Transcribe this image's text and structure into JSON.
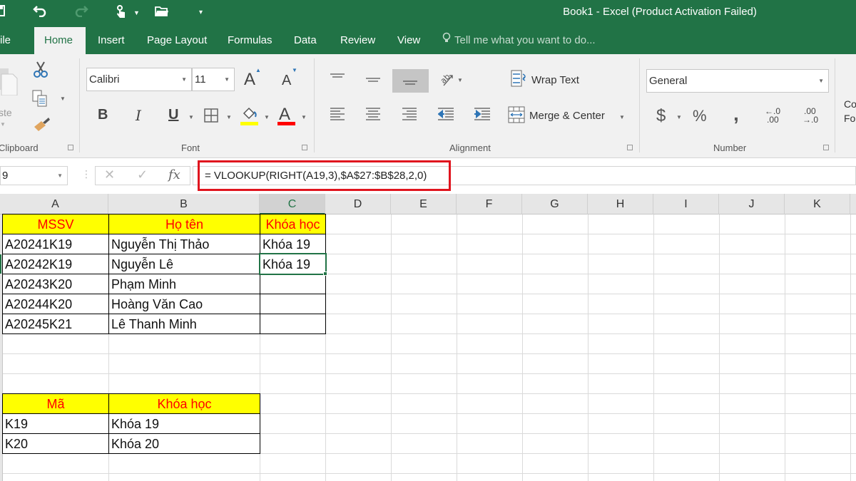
{
  "window": {
    "title": "Book1 - Excel (Product Activation Failed)"
  },
  "quick_access": {
    "save_icon": "save-icon",
    "undo_icon": "undo-icon",
    "redo_icon": "redo-icon",
    "touch_mode_icon": "touch-mode-icon",
    "open_icon": "open-folder-icon",
    "customize_icon": "customize-qat-icon"
  },
  "tabs": [
    {
      "label": "ile"
    },
    {
      "label": "Home",
      "active": true
    },
    {
      "label": "Insert"
    },
    {
      "label": "Page Layout"
    },
    {
      "label": "Formulas"
    },
    {
      "label": "Data"
    },
    {
      "label": "Review"
    },
    {
      "label": "View"
    }
  ],
  "tell_me": {
    "placeholder": "Tell me what you want to do..."
  },
  "ribbon": {
    "clipboard": {
      "label": "Clipboard",
      "paste_label": "ste"
    },
    "font": {
      "label": "Font",
      "font_name": "Calibri",
      "font_size": "11",
      "bold": "B",
      "italic": "I",
      "underline": "U",
      "grow_font": "A",
      "shrink_font": "A",
      "font_color_letter": "A",
      "highlight_color": "#ffff00",
      "font_color": "#ff0000"
    },
    "alignment": {
      "label": "Alignment",
      "wrap_text": "Wrap Text",
      "merge_center": "Merge & Center"
    },
    "number": {
      "label": "Number",
      "format": "General",
      "currency": "$",
      "percent": "%",
      "comma": ",",
      "increase_decimal_top": "←.0",
      "increase_decimal_bottom": ".00",
      "decrease_decimal_top": ".00",
      "decrease_decimal_bottom": "→.0"
    },
    "styles": {
      "conditional_formatting_line1": "Co",
      "conditional_formatting_line2": "For"
    }
  },
  "formula_bar": {
    "name_box": "9",
    "cancel": "✕",
    "enter": "✓",
    "fx": "fx",
    "formula": "= VLOOKUP(RIGHT(A19,3),$A$27:$B$28,2,0)"
  },
  "columns": [
    "A",
    "B",
    "C",
    "D",
    "E",
    "F",
    "G",
    "H",
    "I",
    "J",
    "K"
  ],
  "selected_column": "C",
  "table_students": {
    "headers": [
      "MSSV",
      "Họ tên",
      "Khóa học"
    ],
    "rows": [
      [
        "A20241K19",
        "Nguyễn Thị Thảo",
        "Khóa 19"
      ],
      [
        "A20242K19",
        "Nguyễn Lê",
        "Khóa 19"
      ],
      [
        "A20243K20",
        "Phạm Minh",
        ""
      ],
      [
        "A20244K20",
        "Hoàng Văn Cao",
        ""
      ],
      [
        "A20245K21",
        "Lê Thanh Minh",
        ""
      ]
    ]
  },
  "table_lookup": {
    "headers": [
      "Mã",
      "Khóa học"
    ],
    "rows": [
      [
        "K19",
        "Khóa 19"
      ],
      [
        "K20",
        "Khóa 20"
      ]
    ]
  },
  "colors": {
    "excel_green": "#217346",
    "header_fill": "#ffff00",
    "header_text": "#ff0000",
    "highlight_border": "#e0141e"
  }
}
